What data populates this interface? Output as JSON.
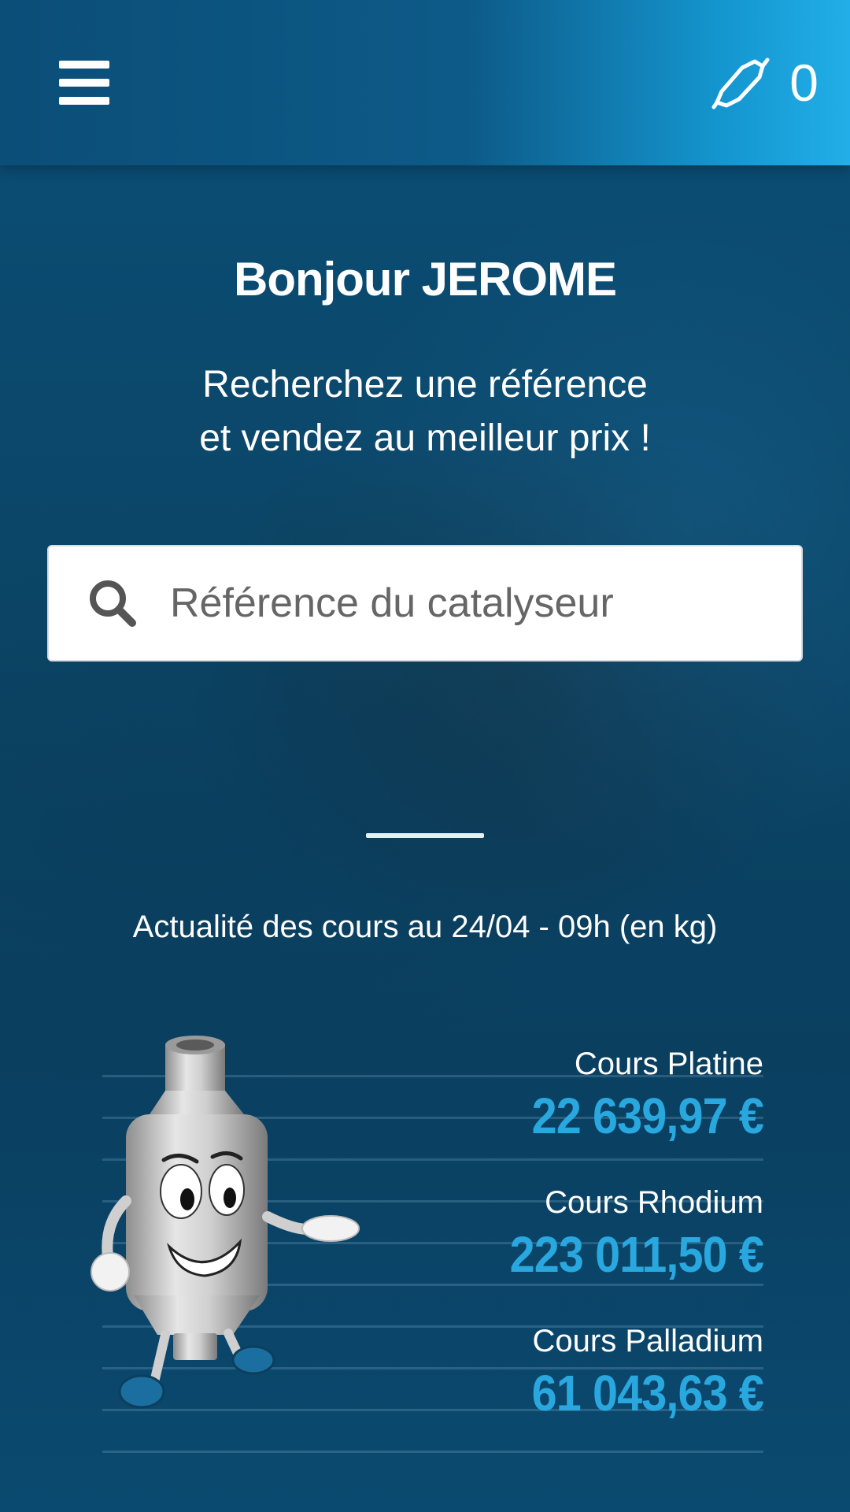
{
  "header": {
    "menu_icon": "hamburger-menu-icon",
    "cart_icon": "catalytic-converter-icon",
    "cart_count": "0",
    "gradient": [
      "#0b4e78",
      "#22aee8"
    ]
  },
  "greeting": "Bonjour JEROME",
  "subtitle_line1": "Recherchez une référence",
  "subtitle_line2": "et vendez au meilleur prix !",
  "search": {
    "placeholder": "Référence du catalyseur",
    "value": "",
    "icon": "search-icon"
  },
  "rates": {
    "title": "Actualité des cours au 24/04 - 09h (en kg)",
    "items": [
      {
        "label": "Cours Platine",
        "value": "22 639,97 €"
      },
      {
        "label": "Cours Rhodium",
        "value": "223 011,50 €"
      },
      {
        "label": "Cours Palladium",
        "value": "61 043,63 €"
      }
    ],
    "accent_color": "#29a8e0"
  },
  "mascot": "catalytic-converter-mascot"
}
